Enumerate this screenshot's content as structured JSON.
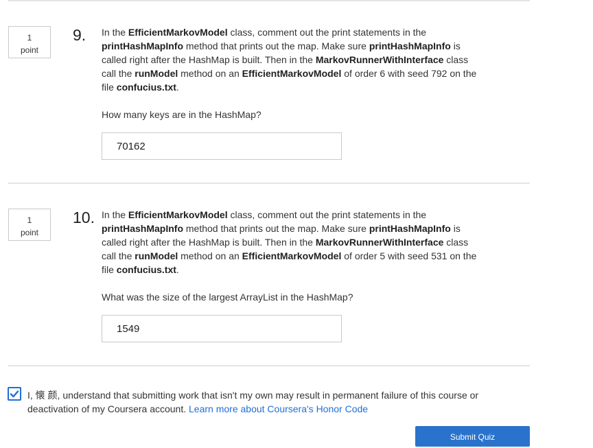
{
  "questions": [
    {
      "points_value": "1",
      "points_unit": "point",
      "number": "9.",
      "text_parts": {
        "p1": "In the ",
        "b1": "EfficientMarkovModel",
        "p2": " class, comment out the print statements in the ",
        "b2": "printHashMapInfo",
        "p3": " method that prints out the map. Make sure ",
        "b3": "printHashMapInfo",
        "p4": " is called right after the HashMap is built. Then in the ",
        "b4": "MarkovRunnerWithInterface",
        "p5": " class call the ",
        "b5": "runModel",
        "p6": " method on an ",
        "b6": "EfficientMarkovModel",
        "p7": " of order 6 with seed 792 on the file ",
        "b7": "confucius.txt",
        "p8": "."
      },
      "prompt": "How many keys are in the HashMap?",
      "answer": "70162"
    },
    {
      "points_value": "1",
      "points_unit": "point",
      "number": "10.",
      "text_parts": {
        "p1": "In the ",
        "b1": "EfficientMarkovModel",
        "p2": " class, comment out the print statements in the ",
        "b2": "printHashMapInfo",
        "p3": " method that prints out the map. Make sure ",
        "b3": "printHashMapInfo",
        "p4": " is called right after the HashMap is built. Then in the ",
        "b4": "MarkovRunnerWithInterface",
        "p5": " class call the ",
        "b5": "runModel",
        "p6": " method on an ",
        "b6": "EfficientMarkovModel",
        "p7": " of order 5 with seed 531 on the file ",
        "b7": "confucius.txt",
        "p8": "."
      },
      "prompt": "What was the size of the largest ArrayList in the HashMap?",
      "answer": "1549"
    }
  ],
  "honor": {
    "checked": true,
    "text": "I, 懐 颜, understand that submitting work that isn't my own may result in permanent failure of this course or deactivation of my Coursera account. ",
    "link_text": "Learn more about Coursera's Honor Code",
    "check_icon": "checkmark-icon"
  },
  "submit_label": "Submit Quiz",
  "colors": {
    "accent": "#2a73cc",
    "link": "#1f6fd6",
    "divider": "#e4e4e4"
  }
}
